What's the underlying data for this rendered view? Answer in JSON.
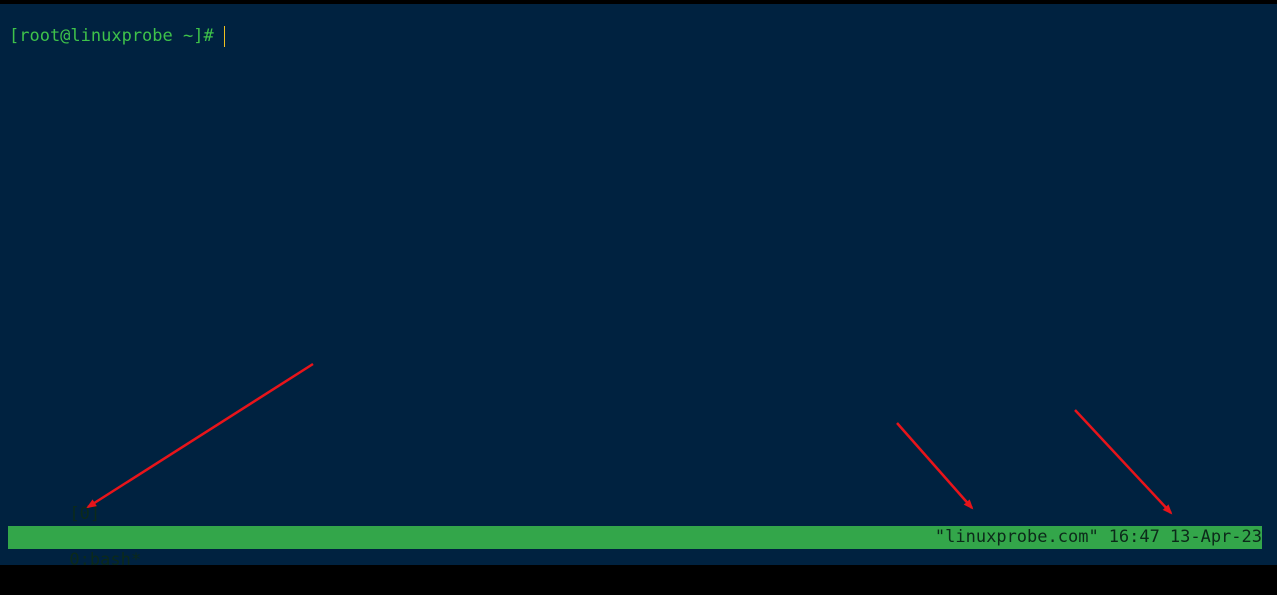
{
  "terminal": {
    "prompt": "[root@linuxprobe ~]#"
  },
  "status_bar": {
    "session": "[0]",
    "window": "0:bash*",
    "host_title": "\"linuxprobe.com\"",
    "time": "16:47",
    "date": "13-Apr-23"
  },
  "colors": {
    "background": "#002240",
    "prompt": "#3ec24a",
    "status_bar": "#33a64a",
    "status_text": "#0c2a1a",
    "cursor": "#f0c020",
    "annotation_arrow": "#e8141a"
  }
}
